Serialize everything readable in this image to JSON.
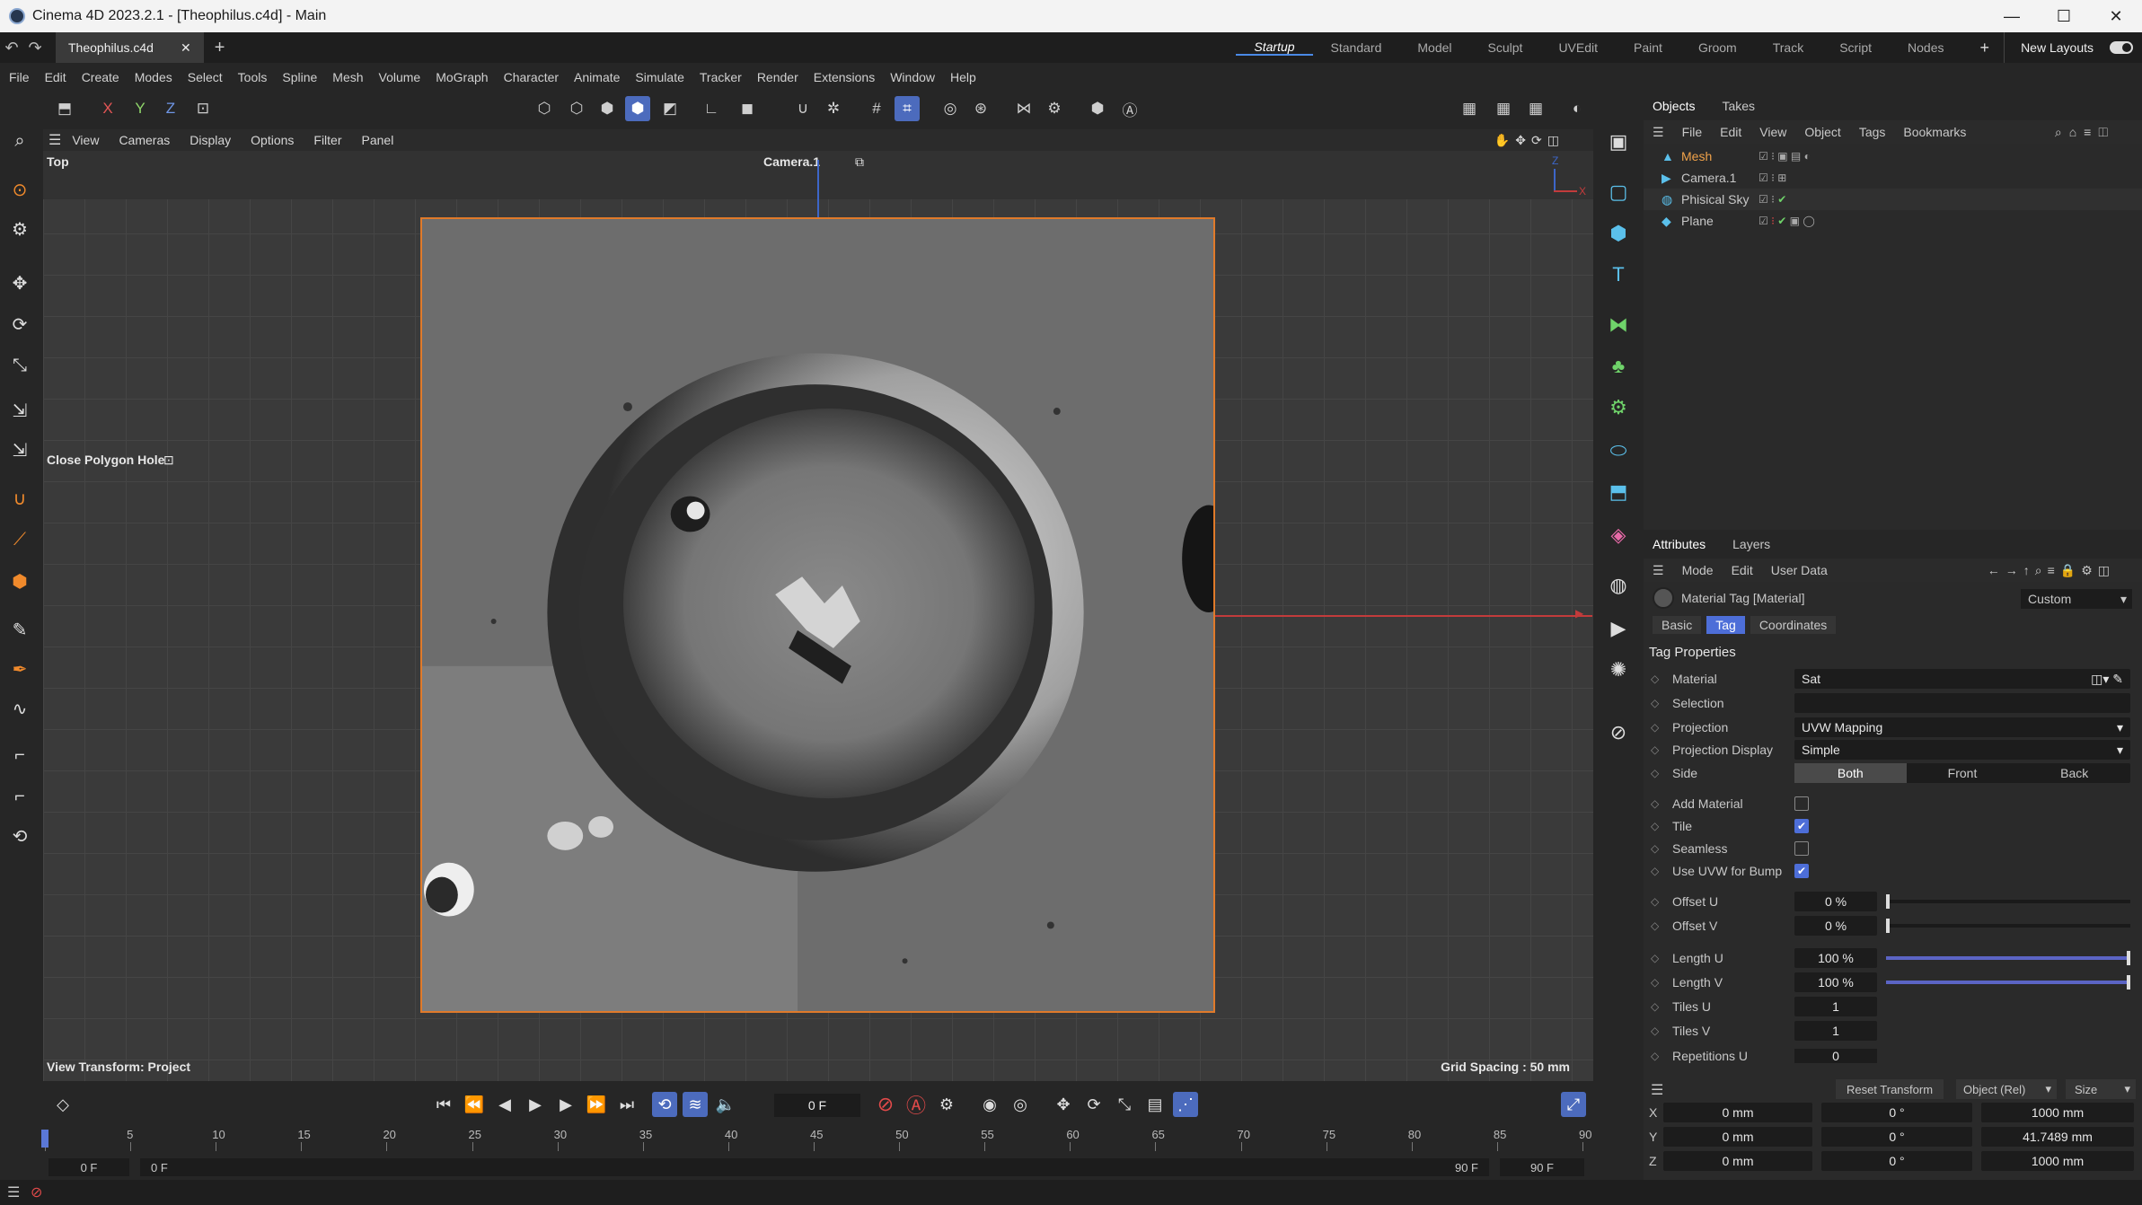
{
  "window": {
    "title": "Cinema 4D 2023.2.1 - [Theophilus.c4d] - Main",
    "min": "—",
    "max": "☐",
    "close": "✕"
  },
  "doc": {
    "tab": "Theophilus.c4d",
    "close": "✕",
    "add": "+"
  },
  "layouts": [
    "Startup",
    "Standard",
    "Model",
    "Sculpt",
    "UVEdit",
    "Paint",
    "Groom",
    "Track",
    "Script",
    "Nodes"
  ],
  "layouts_add": "+",
  "new_layouts": "New Layouts",
  "menu": [
    "File",
    "Edit",
    "Create",
    "Modes",
    "Select",
    "Tools",
    "Spline",
    "Mesh",
    "Volume",
    "MoGraph",
    "Character",
    "Animate",
    "Simulate",
    "Tracker",
    "Render",
    "Extensions",
    "Window",
    "Help"
  ],
  "axis": {
    "x": "X",
    "y": "Y",
    "z": "Z"
  },
  "viewport": {
    "menu": [
      "View",
      "Cameras",
      "Display",
      "Options",
      "Filter",
      "Panel"
    ],
    "view_name": "Top",
    "camera": "Camera.1",
    "tool_hint": "Close Polygon Hole",
    "bottom_left": "View Transform: Project",
    "bottom_right": "Grid Spacing : 50 mm",
    "axis_z": "Z",
    "axis_x": "X"
  },
  "objects_panel": {
    "tabs": [
      "Objects",
      "Takes"
    ],
    "menu": [
      "File",
      "Edit",
      "View",
      "Object",
      "Tags",
      "Bookmarks"
    ],
    "items": [
      {
        "name": "Mesh",
        "icon": "mesh-icon"
      },
      {
        "name": "Camera.1",
        "icon": "camera-icon"
      },
      {
        "name": "Phisical Sky",
        "icon": "sky-icon"
      },
      {
        "name": "Plane",
        "icon": "plane-icon"
      }
    ]
  },
  "attributes": {
    "tabs": [
      "Attributes",
      "Layers"
    ],
    "menu": [
      "Mode",
      "Edit",
      "User Data"
    ],
    "header": "Material Tag [Material]",
    "preset": "Custom",
    "subtabs": [
      "Basic",
      "Tag",
      "Coordinates"
    ],
    "section": "Tag Properties",
    "material_label": "Material",
    "material_value": "Sat",
    "selection_label": "Selection",
    "projection_label": "Projection",
    "projection_value": "UVW Mapping",
    "projection_display_label": "Projection Display",
    "projection_display_value": "Simple",
    "side_label": "Side",
    "side_options": [
      "Both",
      "Front",
      "Back"
    ],
    "add_material_label": "Add Material",
    "tile_label": "Tile",
    "seamless_label": "Seamless",
    "use_uvw_label": "Use UVW for Bump",
    "offset_u_label": "Offset U",
    "offset_u": "0 %",
    "offset_v_label": "Offset V",
    "offset_v": "0 %",
    "length_u_label": "Length U",
    "length_u": "100 %",
    "length_v_label": "Length V",
    "length_v": "100 %",
    "tiles_u_label": "Tiles U",
    "tiles_u": "1",
    "tiles_v_label": "Tiles V",
    "tiles_v": "1",
    "repetitions_label": "Repetitions U",
    "repetitions_value": "0",
    "length_u_fraction": 1.0,
    "length_v_fraction": 1.0
  },
  "coords": {
    "reset": "Reset Transform",
    "mode": "Object (Rel)",
    "size": "Size",
    "rows": [
      {
        "axis": "X",
        "pos": "0 mm",
        "rot": "0 °",
        "size": "1000 mm"
      },
      {
        "axis": "Y",
        "pos": "0 mm",
        "rot": "0 °",
        "size": "41.7489 mm"
      },
      {
        "axis": "Z",
        "pos": "0 mm",
        "rot": "0 °",
        "size": "1000 mm"
      }
    ]
  },
  "timeline": {
    "frame": "0 F",
    "ticks": [
      "0",
      "5",
      "10",
      "15",
      "20",
      "25",
      "30",
      "35",
      "40",
      "45",
      "50",
      "55",
      "60",
      "65",
      "70",
      "75",
      "80",
      "85",
      "90"
    ],
    "start": "0 F",
    "start2": "0 F",
    "end": "90 F",
    "end2": "90 F"
  }
}
